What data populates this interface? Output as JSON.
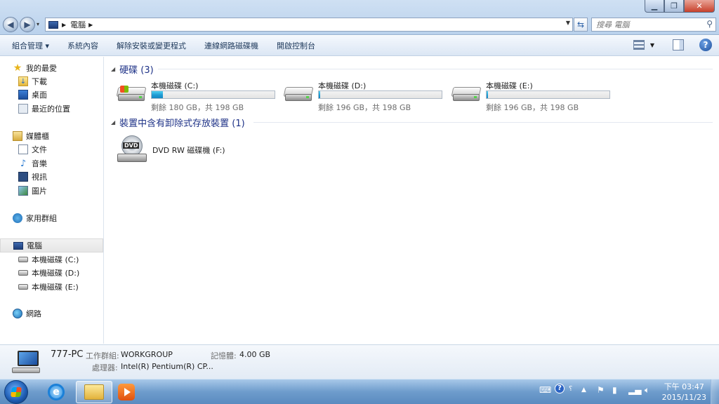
{
  "window": {
    "address_path": "電腦",
    "search_placeholder": "搜尋 電腦"
  },
  "toolbar": {
    "organize": "組合管理 ▾",
    "system_properties": "系統內容",
    "uninstall": "解除安裝或變更程式",
    "map_drive": "連線網路磁碟機",
    "control_panel": "開啟控制台"
  },
  "sidebar": {
    "favorites": "我的最愛",
    "downloads": "下載",
    "desktop": "桌面",
    "recent": "最近的位置",
    "libraries": "媒體櫃",
    "documents": "文件",
    "music": "音樂",
    "videos": "視訊",
    "pictures": "圖片",
    "homegroup": "家用群組",
    "computer": "電腦",
    "drive_c": "本機磁碟 (C:)",
    "drive_d": "本機磁碟 (D:)",
    "drive_e": "本機磁碟 (E:)",
    "network": "網路"
  },
  "content": {
    "hdd_group": "硬碟 (3)",
    "removable_group": "裝置中含有卸除式存放裝置 (1)",
    "drives": [
      {
        "name": "本機磁碟 (C:)",
        "size_text": "剩餘 180 GB，共 198 GB",
        "used_fraction": 0.09
      },
      {
        "name": "本機磁碟 (D:)",
        "size_text": "剩餘 196 GB，共 198 GB",
        "used_fraction": 0.01
      },
      {
        "name": "本機磁碟 (E:)",
        "size_text": "剩餘 196 GB，共 198 GB",
        "used_fraction": 0.01
      }
    ],
    "dvd_name": "DVD RW 磁碟機 (F:)",
    "dvd_label": "DVD"
  },
  "details": {
    "pc_name": "777-PC",
    "workgroup_label": "工作群組:",
    "workgroup_value": "WORKGROUP",
    "memory_label": "記憶體:",
    "memory_value": "4.00 GB",
    "processor_label": "處理器:",
    "processor_value": "Intel(R) Pentium(R) CP..."
  },
  "taskbar": {
    "time": "下午 03:47",
    "date": "2015/11/23"
  },
  "colors": {
    "accent": "#1e3287",
    "bar_fill": "#1f9bd3"
  }
}
